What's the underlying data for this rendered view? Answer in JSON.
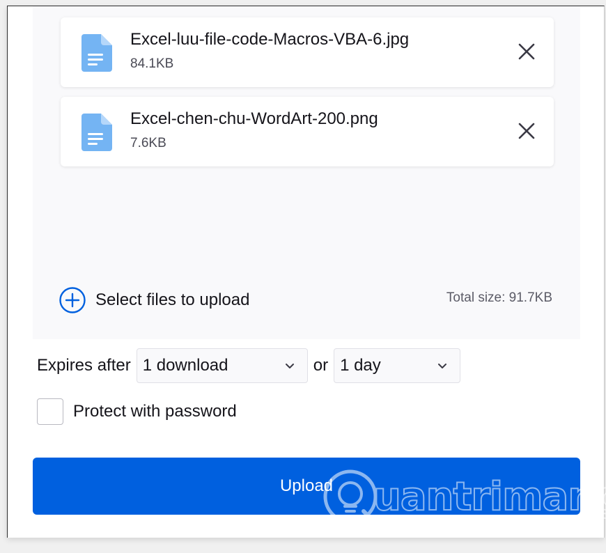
{
  "files": [
    {
      "name": "Excel-luu-file-code-Macros-VBA-6.jpg",
      "size": "84.1KB",
      "icon": "document-icon"
    },
    {
      "name": "Excel-chen-chu-WordArt-200.png",
      "size": "7.6KB",
      "icon": "document-icon"
    }
  ],
  "select_files_label": "Select files to upload",
  "total_size": "Total size: 91.7KB",
  "expires": {
    "label": "Expires after",
    "downloads_value": "1 download",
    "or_label": "or",
    "time_value": "1 day"
  },
  "password": {
    "label": "Protect with password",
    "checked": false
  },
  "upload_label": "Upload",
  "watermark_text": "uantrimang",
  "colors": {
    "accent": "#0060df",
    "file_icon": "#74b4f3",
    "drop_area_bg": "#f9f9fb"
  }
}
